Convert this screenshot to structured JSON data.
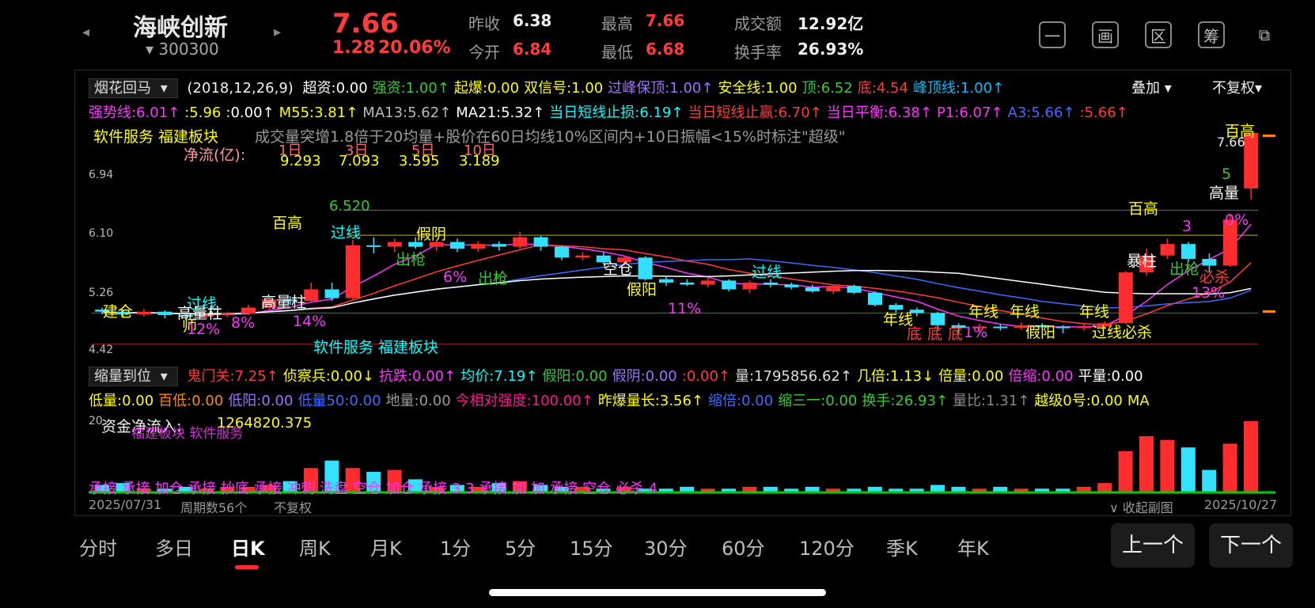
{
  "header": {
    "stock_name": "海峡创新",
    "stock_code": "300300",
    "price": "7.66",
    "change": "1.28",
    "change_pct": "20.06%",
    "prev_close_label": "昨收",
    "prev_close": "6.38",
    "open_label": "今开",
    "open": "6.84",
    "high_label": "最高",
    "high": "7.66",
    "low_label": "最低",
    "low": "6.68",
    "turnover_amt_label": "成交额",
    "turnover_amt": "12.92亿",
    "turnover_rate_label": "换手率",
    "turnover_rate": "26.93%",
    "icons": [
      "minimize-icon",
      "fullscreen-icon",
      "region-icon",
      "chip-icon",
      "split-screen-icon"
    ],
    "icon_glyphs": [
      "一",
      "画",
      "区",
      "筹",
      "⧉"
    ]
  },
  "main_indicator": {
    "name": "烟花回马",
    "params": "(2018,12,26,9)",
    "overlay": "叠加",
    "adjust": "不复权",
    "row1": [
      {
        "t": "超资:0.00",
        "c": "#ffffff"
      },
      {
        "t": "强资:1.00↑",
        "c": "#32cd32"
      },
      {
        "t": "起爆:0.00",
        "c": "#ffff00"
      },
      {
        "t": "双信号:1.00",
        "c": "#ffff00"
      },
      {
        "t": "过峰保顶:1.00↑",
        "c": "#a070ff"
      },
      {
        "t": "安全线:1.00",
        "c": "#ffff00"
      },
      {
        "t": "顶:6.52",
        "c": "#32cd32"
      },
      {
        "t": "底:4.54",
        "c": "#ff3b3b"
      },
      {
        "t": "峰顶线:1.00↑",
        "c": "#00bfff"
      }
    ],
    "row2": [
      {
        "t": "强势线:6.01↑",
        "c": "#ff33ff"
      },
      {
        "t": ":5.96",
        "c": "#ffff00"
      },
      {
        "t": ":0.00↑",
        "c": "#ffffff"
      },
      {
        "t": "M55:3.81↑",
        "c": "#ffff00"
      },
      {
        "t": "MA13:5.62↑",
        "c": "#bbbbbb"
      },
      {
        "t": "MA21:5.32↑",
        "c": "#ffffff"
      },
      {
        "t": "当日短线止损:6.19↑",
        "c": "#00ffff"
      },
      {
        "t": "当日短线止赢:6.70↑",
        "c": "#ff3b3b"
      },
      {
        "t": "当日平衡:6.38↑",
        "c": "#ff33ff"
      },
      {
        "t": "P1:6.07↑",
        "c": "#ff33ff"
      },
      {
        "t": "A3:5.66↑",
        "c": "#3d6bff"
      },
      {
        "t": ":5.66↑",
        "c": "#ff3b3b"
      }
    ]
  },
  "chart_overlay_text": {
    "sector": "软件服务 福建板块",
    "note": "成交量突增1.8倍于20均量+股价在60日均线10%区间内+10日振幅<15%时标注\"超级\"",
    "net_flow_label": "净流(亿):",
    "periods": [
      "1日",
      "3日",
      "5日",
      "10日"
    ],
    "flows": [
      "9.293",
      "7.093",
      "3.595",
      "3.189"
    ],
    "y_ticks": [
      "6.94",
      "6.10",
      "5.26",
      "4.42"
    ],
    "top_right_price": "7.66",
    "level_line": "6.520",
    "bottom_sector": "软件服务 福建板块",
    "signals": [
      "建仓",
      "过线",
      "高量柱",
      "师",
      "12%",
      "8%",
      "14%",
      "高量柱",
      "百高",
      "过线",
      "假阴",
      "出枪",
      "6%",
      "出枪",
      "空仓",
      "假阳",
      "11%",
      "过线",
      "年线",
      "底",
      "底",
      "底",
      "1%",
      "年线",
      "年线",
      "假阳",
      "年线",
      "过线必杀",
      "百高",
      "暴柱",
      "出枪",
      "13%",
      "必杀",
      "3",
      "高量",
      "百高",
      "5",
      "0%"
    ]
  },
  "sub_indicator": {
    "name": "缩量到位",
    "row1": [
      {
        "t": "鬼门关:7.25↑",
        "c": "#ff3b3b"
      },
      {
        "t": "侦察兵:0.00↓",
        "c": "#ffff00"
      },
      {
        "t": "抗跌:0.00↑",
        "c": "#ff33ff"
      },
      {
        "t": "均价:7.19↑",
        "c": "#00ffff"
      },
      {
        "t": "假阳:0.00",
        "c": "#32cd32"
      },
      {
        "t": "假阴:0.00",
        "c": "#a070ff"
      },
      {
        "t": ":0.00↑",
        "c": "#ff3b3b"
      },
      {
        "t": "量:1795856.62↑",
        "c": "#dddddd"
      },
      {
        "t": "几倍:1.13↓",
        "c": "#ffff00"
      },
      {
        "t": "倍量:0.00",
        "c": "#ffff00"
      },
      {
        "t": "倍缩:0.00",
        "c": "#ff33ff"
      },
      {
        "t": "平量:0.00",
        "c": "#ffffff"
      }
    ],
    "row2": [
      {
        "t": "低量:0.00",
        "c": "#ffff00"
      },
      {
        "t": "百低:0.00",
        "c": "#ff8a00"
      },
      {
        "t": "低阳:0.00",
        "c": "#a070ff"
      },
      {
        "t": "低量50:0.00",
        "c": "#3d6bff"
      },
      {
        "t": "地量:0.00",
        "c": "#9a9a9a"
      },
      {
        "t": "今相对强度:100.00↑",
        "c": "#ff1493"
      },
      {
        "t": "昨爆量长:3.56↑",
        "c": "#ffff00"
      },
      {
        "t": "缩倍:0.00",
        "c": "#3d6bff"
      },
      {
        "t": "缩三一:0.00",
        "c": "#32cd32"
      },
      {
        "t": "换手:26.93↑",
        "c": "#32cd32"
      },
      {
        "t": "量比:1.31↑",
        "c": "#888888"
      },
      {
        "t": "越级0号:0.00",
        "c": "#ffff00"
      },
      {
        "t": "MA",
        "c": "#ffff00"
      }
    ],
    "flow_label": "资金净流入:",
    "flow_value": "1264820.375",
    "flow_sector": "福建板块 软件服务",
    "y_tick": "20",
    "bottom_signals": "承接 承接 加仓 承接 抄底 承接 冲刺 洗盘 空仓 加仓 承接 3 3 承接 加 加 承接 空仓 必杀 4"
  },
  "footer_info": {
    "start_date": "2025/07/31",
    "period_count": "周期数56个",
    "adjust": "不复权",
    "collapse": "∨ 收起副图",
    "end_date": "2025/10/27"
  },
  "timeframes": [
    "分时",
    "多日",
    "日K",
    "周K",
    "月K",
    "1分",
    "5分",
    "15分",
    "30分",
    "60分",
    "120分",
    "季K",
    "年K"
  ],
  "active_timeframe": "日K",
  "nav": {
    "prev": "上一个",
    "next": "下一个"
  },
  "candles": [
    {
      "o": 5.05,
      "c": 5.02,
      "h": 5.08,
      "l": 4.98
    },
    {
      "o": 5.02,
      "c": 4.98,
      "h": 5.05,
      "l": 4.93
    },
    {
      "o": 4.98,
      "c": 5.02,
      "h": 5.06,
      "l": 4.95
    },
    {
      "o": 5.02,
      "c": 4.97,
      "h": 5.04,
      "l": 4.92
    },
    {
      "o": 4.97,
      "c": 4.95,
      "h": 5.0,
      "l": 4.9
    },
    {
      "o": 4.95,
      "c": 4.97,
      "h": 5.0,
      "l": 4.92
    },
    {
      "o": 4.97,
      "c": 4.99,
      "h": 5.02,
      "l": 4.94
    },
    {
      "o": 4.99,
      "c": 5.08,
      "h": 5.12,
      "l": 4.97
    },
    {
      "o": 5.08,
      "c": 5.2,
      "h": 5.22,
      "l": 5.05
    },
    {
      "o": 5.2,
      "c": 5.18,
      "h": 5.25,
      "l": 5.12
    },
    {
      "o": 5.18,
      "c": 5.35,
      "h": 5.45,
      "l": 5.15
    },
    {
      "o": 5.35,
      "c": 5.22,
      "h": 5.45,
      "l": 5.18
    },
    {
      "o": 5.22,
      "c": 6.0,
      "h": 6.08,
      "l": 5.2
    },
    {
      "o": 6.0,
      "c": 5.98,
      "h": 6.12,
      "l": 5.88
    },
    {
      "o": 5.98,
      "c": 6.05,
      "h": 6.1,
      "l": 5.9
    },
    {
      "o": 6.05,
      "c": 5.98,
      "h": 6.12,
      "l": 5.95
    },
    {
      "o": 5.98,
      "c": 6.05,
      "h": 6.08,
      "l": 5.92
    },
    {
      "o": 6.05,
      "c": 5.95,
      "h": 6.1,
      "l": 5.9
    },
    {
      "o": 5.95,
      "c": 6.02,
      "h": 6.06,
      "l": 5.9
    },
    {
      "o": 6.02,
      "c": 5.98,
      "h": 6.06,
      "l": 5.92
    },
    {
      "o": 5.98,
      "c": 6.12,
      "h": 6.2,
      "l": 5.95
    },
    {
      "o": 6.12,
      "c": 5.98,
      "h": 6.14,
      "l": 5.92
    },
    {
      "o": 5.98,
      "c": 5.82,
      "h": 6.0,
      "l": 5.78
    },
    {
      "o": 5.82,
      "c": 5.85,
      "h": 5.9,
      "l": 5.78
    },
    {
      "o": 5.85,
      "c": 5.75,
      "h": 5.9,
      "l": 5.72
    },
    {
      "o": 5.75,
      "c": 5.82,
      "h": 5.85,
      "l": 5.7
    },
    {
      "o": 5.82,
      "c": 5.5,
      "h": 5.84,
      "l": 5.48
    },
    {
      "o": 5.5,
      "c": 5.45,
      "h": 5.55,
      "l": 5.4
    },
    {
      "o": 5.45,
      "c": 5.42,
      "h": 5.5,
      "l": 5.4
    },
    {
      "o": 5.42,
      "c": 5.48,
      "h": 5.52,
      "l": 5.38
    },
    {
      "o": 5.48,
      "c": 5.35,
      "h": 5.5,
      "l": 5.32
    },
    {
      "o": 5.35,
      "c": 5.45,
      "h": 5.48,
      "l": 5.3
    },
    {
      "o": 5.45,
      "c": 5.42,
      "h": 5.5,
      "l": 5.38
    },
    {
      "o": 5.42,
      "c": 5.38,
      "h": 5.45,
      "l": 5.35
    },
    {
      "o": 5.38,
      "c": 5.32,
      "h": 5.42,
      "l": 5.3
    },
    {
      "o": 5.32,
      "c": 5.4,
      "h": 5.42,
      "l": 5.28
    },
    {
      "o": 5.4,
      "c": 5.3,
      "h": 5.42,
      "l": 5.28
    },
    {
      "o": 5.3,
      "c": 5.12,
      "h": 5.32,
      "l": 5.1
    },
    {
      "o": 5.12,
      "c": 5.05,
      "h": 5.15,
      "l": 5.0
    },
    {
      "o": 5.05,
      "c": 5.0,
      "h": 5.08,
      "l": 4.95
    },
    {
      "o": 5.0,
      "c": 4.82,
      "h": 5.02,
      "l": 4.75
    },
    {
      "o": 4.82,
      "c": 4.78,
      "h": 4.85,
      "l": 4.7
    },
    {
      "o": 4.78,
      "c": 4.8,
      "h": 4.84,
      "l": 4.72
    },
    {
      "o": 4.8,
      "c": 4.78,
      "h": 4.83,
      "l": 4.74
    },
    {
      "o": 4.78,
      "c": 4.82,
      "h": 4.86,
      "l": 4.75
    },
    {
      "o": 4.82,
      "c": 4.8,
      "h": 4.85,
      "l": 4.76
    },
    {
      "o": 4.8,
      "c": 4.78,
      "h": 4.82,
      "l": 4.7
    },
    {
      "o": 4.78,
      "c": 4.8,
      "h": 4.84,
      "l": 4.74
    },
    {
      "o": 4.8,
      "c": 4.85,
      "h": 4.88,
      "l": 4.76
    },
    {
      "o": 4.85,
      "c": 5.6,
      "h": 5.62,
      "l": 4.84
    },
    {
      "o": 5.6,
      "c": 5.85,
      "h": 5.95,
      "l": 5.55
    },
    {
      "o": 5.85,
      "c": 6.02,
      "h": 6.1,
      "l": 5.8
    },
    {
      "o": 6.02,
      "c": 5.8,
      "h": 6.05,
      "l": 5.75
    },
    {
      "o": 5.8,
      "c": 5.7,
      "h": 5.88,
      "l": 5.6
    },
    {
      "o": 5.7,
      "c": 6.38,
      "h": 6.45,
      "l": 5.68
    },
    {
      "o": 6.84,
      "c": 7.66,
      "h": 7.66,
      "l": 6.68
    }
  ],
  "volumes": [
    4,
    5,
    2,
    2,
    3,
    2,
    3,
    3,
    4,
    6,
    13,
    17,
    13,
    11,
    12,
    7,
    3,
    4,
    3,
    5,
    6,
    4,
    3,
    3,
    2,
    3,
    2,
    2,
    3,
    2,
    2,
    3,
    3,
    2,
    3,
    2,
    2,
    3,
    2,
    2,
    4,
    3,
    2,
    3,
    2,
    2,
    2,
    3,
    5,
    22,
    30,
    28,
    24,
    12,
    26,
    38
  ]
}
